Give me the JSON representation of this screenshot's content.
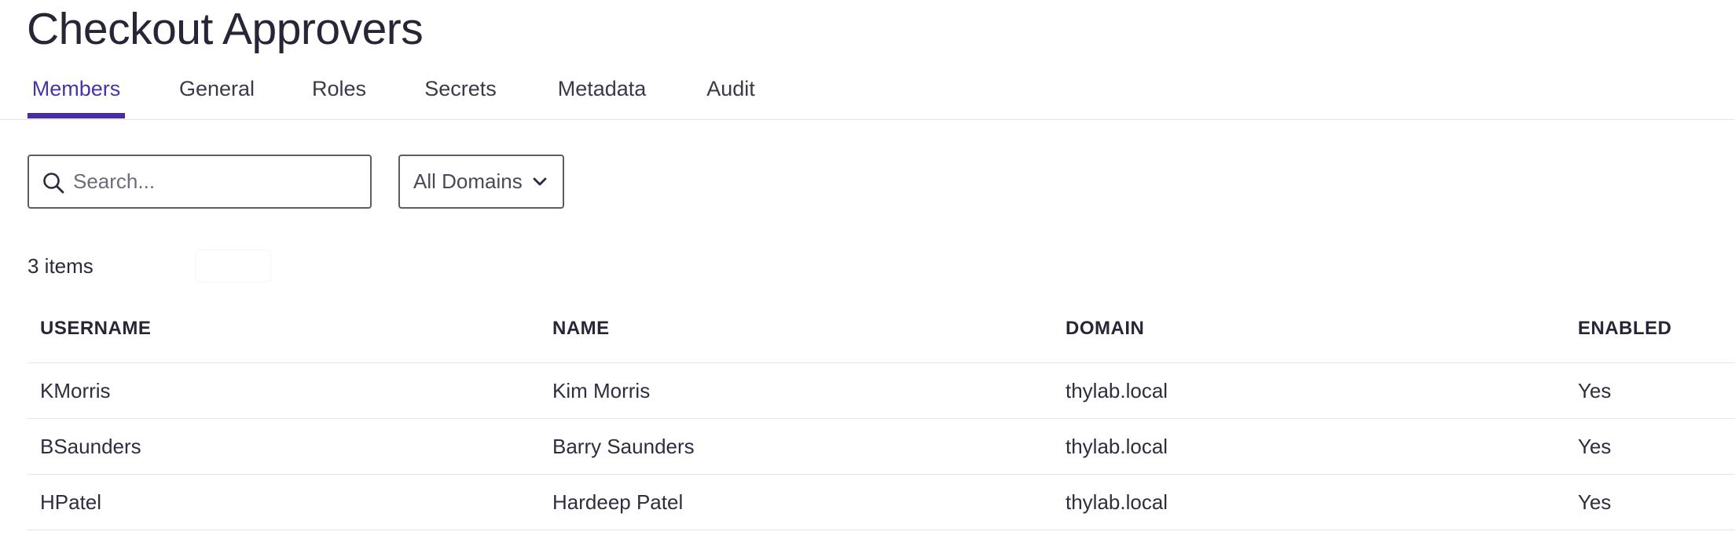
{
  "page": {
    "title": "Checkout Approvers"
  },
  "tabs": [
    {
      "label": "Members",
      "active": true
    },
    {
      "label": "General",
      "active": false
    },
    {
      "label": "Roles",
      "active": false
    },
    {
      "label": "Secrets",
      "active": false
    },
    {
      "label": "Metadata",
      "active": false
    },
    {
      "label": "Audit",
      "active": false
    }
  ],
  "toolbar": {
    "search": {
      "placeholder": "Search...",
      "value": "",
      "icon": "search-icon"
    },
    "domain_filter": {
      "selected": "All Domains",
      "icon": "chevron-down-icon"
    }
  },
  "list": {
    "count_label": "3 items"
  },
  "table": {
    "columns": [
      "USERNAME",
      "NAME",
      "DOMAIN",
      "ENABLED"
    ],
    "rows": [
      [
        "KMorris",
        "Kim Morris",
        "thylab.local",
        "Yes"
      ],
      [
        "BSaunders",
        "Barry Saunders",
        "thylab.local",
        "Yes"
      ],
      [
        "HPatel",
        "Hardeep Patel",
        "thylab.local",
        "Yes"
      ]
    ]
  },
  "colors": {
    "accent": "#4a2ba6",
    "text": "#262636",
    "border": "#5c5b6e",
    "divider": "#e4e4ea"
  }
}
